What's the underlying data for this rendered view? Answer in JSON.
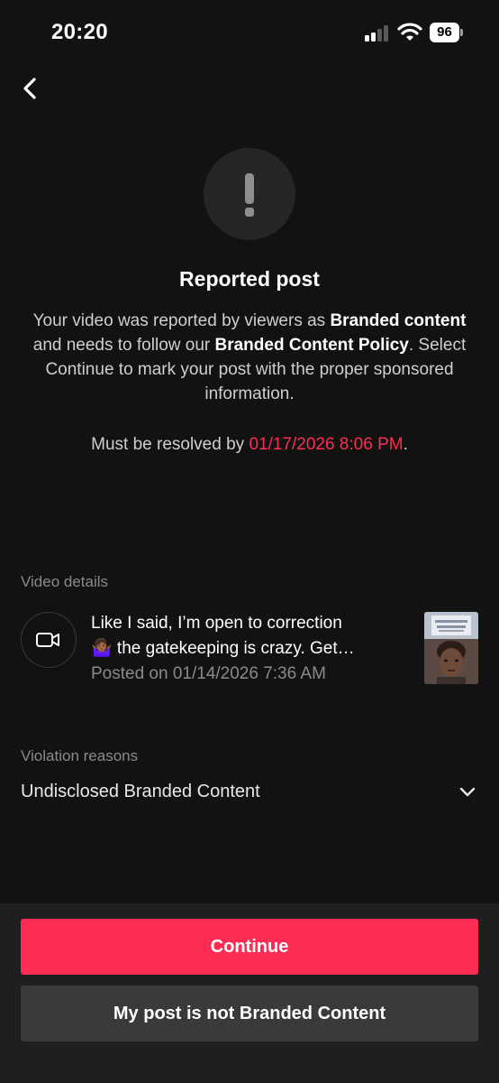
{
  "status_bar": {
    "time": "20:20",
    "battery": "96"
  },
  "page": {
    "title": "Reported post",
    "description": {
      "part1": "Your video was reported by viewers as ",
      "bold1": "Branded content",
      "part2": " and needs to follow our ",
      "bold2": "Branded Content Policy",
      "part3": ". Select Continue to mark your post with the proper sponsored information."
    },
    "deadline": {
      "prefix": "Must be resolved by ",
      "date": "01/17/2026 8:06 PM",
      "suffix": "."
    }
  },
  "video_details": {
    "label": "Video details",
    "caption_line1": "Like I said, I’m open to correction",
    "caption_line2": "🤷🏾‍♀️ the gatekeeping is crazy. Get…",
    "posted": "Posted on 01/14/2026 7:36 AM"
  },
  "violation": {
    "label": "Violation reasons",
    "selected": "Undisclosed Branded Content"
  },
  "actions": {
    "continue_label": "Continue",
    "not_branded_label": "My post is not Branded Content"
  },
  "icons": {
    "back": "chevron-left-icon",
    "alert": "exclamation-icon",
    "video": "video-camera-icon",
    "dropdown": "chevron-down-icon"
  },
  "colors": {
    "background": "#121212",
    "accent": "#fe2c55",
    "secondary_button": "#3a3a3a",
    "panel": "#1f1f1f"
  }
}
